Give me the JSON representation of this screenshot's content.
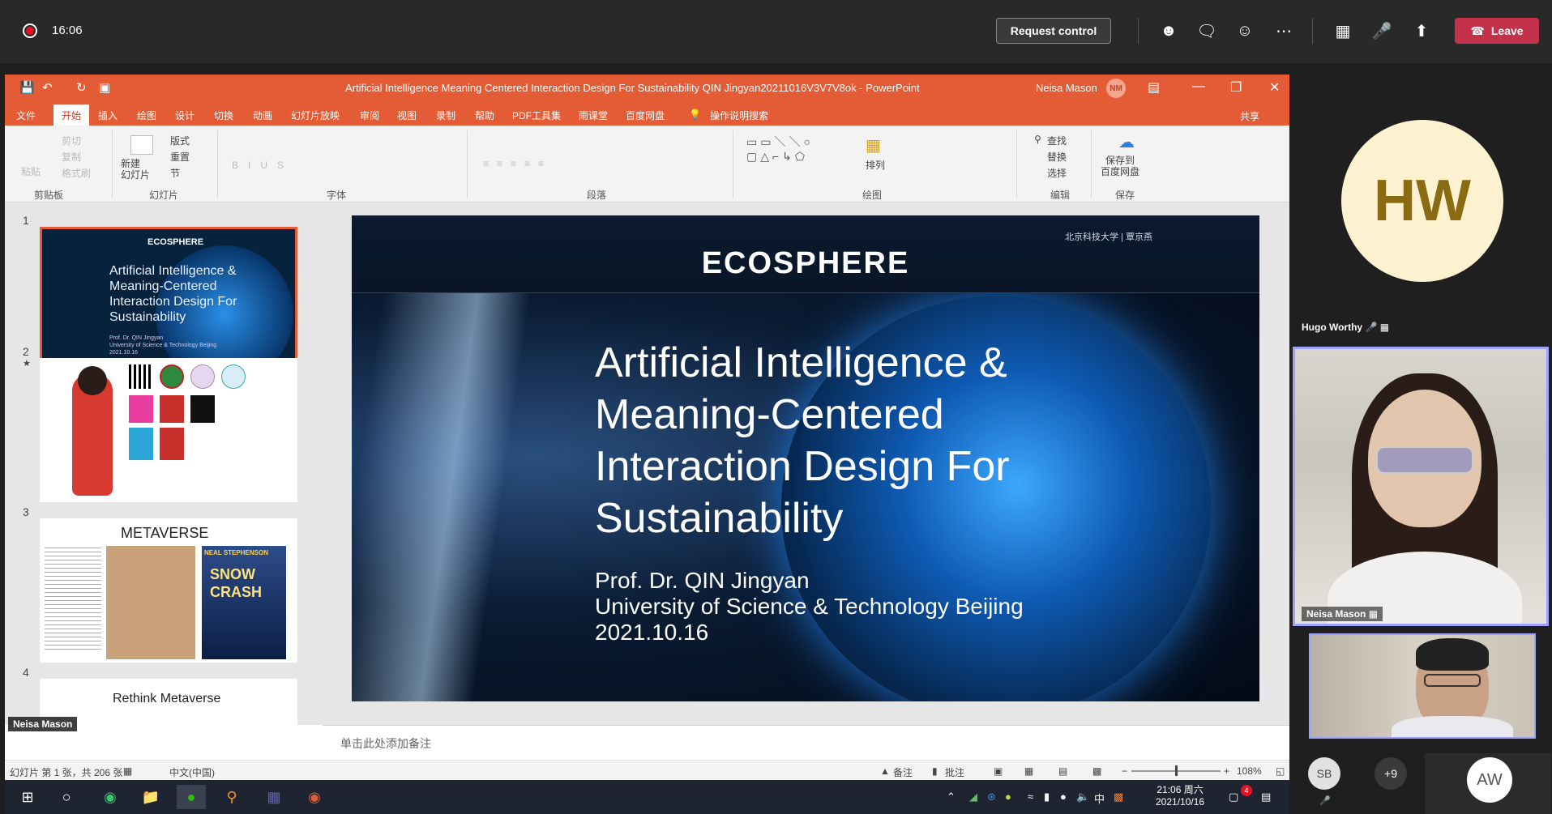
{
  "teams": {
    "timer": "16:06",
    "request_control": "Request control",
    "leave": "Leave",
    "toolbar_icons": [
      "people-icon",
      "chat-icon",
      "reactions-icon",
      "more-icon",
      "camera-off-icon",
      "mic-off-icon",
      "share-icon"
    ]
  },
  "ppt": {
    "window_title": "Artificial Intelligence Meaning Centered Interaction Design For Sustainability QIN Jingyan20211016V3V7V8ok  -  PowerPoint",
    "user_name": "Neisa Mason",
    "user_initials": "NM",
    "tabs": [
      "文件",
      "开始",
      "插入",
      "绘图",
      "设计",
      "切换",
      "动画",
      "幻灯片放映",
      "审阅",
      "视图",
      "录制",
      "帮助",
      "PDF工具集",
      "雨课堂",
      "百度网盘"
    ],
    "active_tab": "开始",
    "tell_me": "操作说明搜索",
    "share": "共享",
    "ribbon": {
      "clipboard_items": [
        "粘贴",
        "剪切",
        "复制",
        "格式刷"
      ],
      "slides_new": "新建\n幻灯片",
      "layout": "版式",
      "reset": "重置",
      "section": "节",
      "find": "查找",
      "replace": "替换",
      "select": "选择",
      "arrange": "排列",
      "save_to_baidu": "保存到\n百度网盘",
      "groups": [
        "剪贴板",
        "幻灯片",
        "字体",
        "段落",
        "绘图",
        "编辑",
        "保存"
      ]
    },
    "thumbnails": {
      "slide1": {
        "num": "1",
        "brand": "ECOSPHERE",
        "title": "Artificial Intelligence &\nMeaning-Centered\nInteraction Design For\nSustainability",
        "sub": "Prof. Dr. QIN Jingyan\nUniversity of Science & Technology Beijing\n2021.10.16"
      },
      "slide2": {
        "num": "2",
        "star": "★"
      },
      "slide3": {
        "num": "3",
        "title": "METAVERSE",
        "book_title": "SNOW CRASH",
        "book_author": "NEAL STEPHENSON"
      },
      "slide4": {
        "num": "4",
        "title": "Rethink Metaverse"
      }
    },
    "slide": {
      "brand": "ECOSPHERE",
      "logo_text": "北京科技大学 | 覃京燕",
      "title": "Artificial Intelligence &\nMeaning-Centered\nInteraction Design For\nSustainability",
      "author": "Prof. Dr. QIN Jingyan",
      "affiliation": "University of Science & Technology Beijing",
      "date": "2021.10.16"
    },
    "notes_placeholder": "单击此处添加备注",
    "status": {
      "slide_count": "幻灯片 第 1 张，共 206 张",
      "language": "中文(中国)",
      "notes": "备注",
      "comments": "批注",
      "zoom": "108%"
    }
  },
  "taskbar": {
    "time": "21:06 周六",
    "date": "2021/10/16",
    "ime": "中",
    "notif_count": "4"
  },
  "participants": {
    "hugo": {
      "initials": "HW",
      "name": "Hugo Worthy"
    },
    "neisa": {
      "name": "Neisa Mason"
    },
    "sb": "SB",
    "more": "+9",
    "aw": "AW"
  },
  "colors": {
    "ppt_orange": "#e35c35",
    "teams_leave": "#c4314b",
    "speaker_border": "#9ea2ff"
  }
}
